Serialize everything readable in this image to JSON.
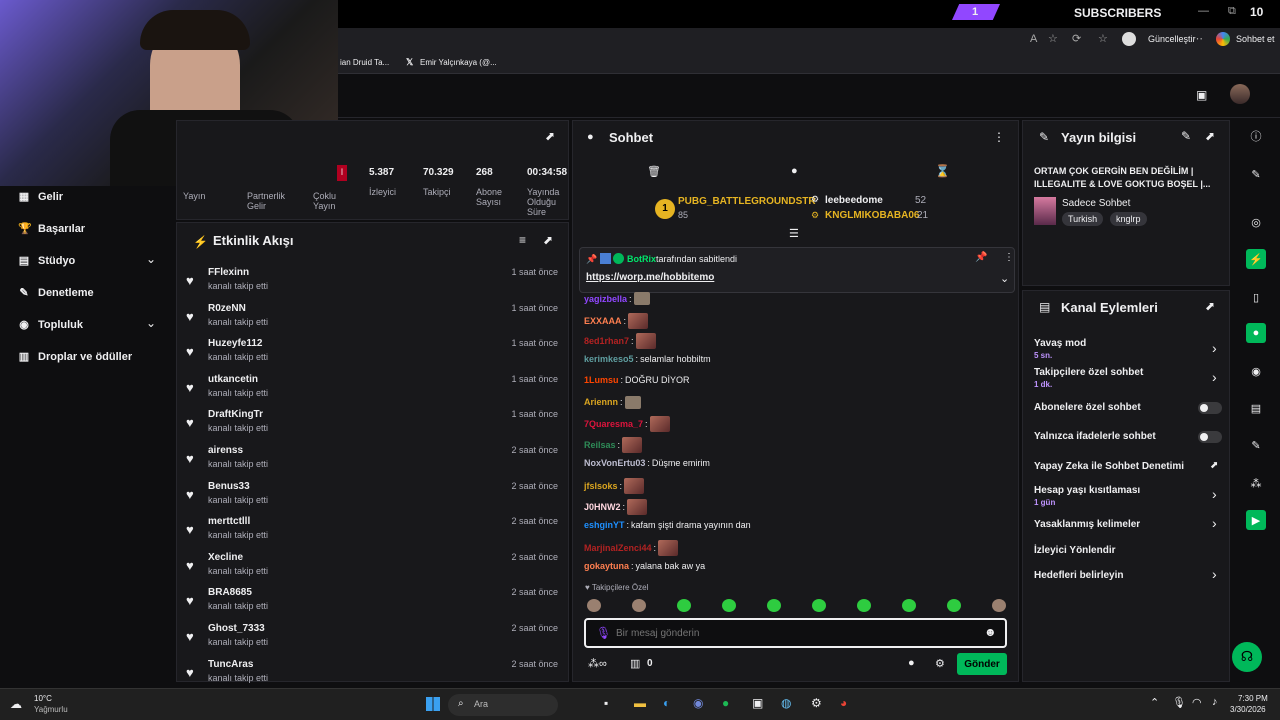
{
  "overlay": {
    "sub_count": "1",
    "subscribers_label": "SUBSCRIBERS",
    "sub_total": "10"
  },
  "browser": {
    "update_label": "Güncelleştir",
    "chat_tab": "Sohbet et",
    "bookmark1": "ian Druid Ta...",
    "bookmark2": "Emir Yalçınkaya (@..."
  },
  "stats": {
    "tiles": [
      {
        "value": "5.387",
        "label": "İzleyici"
      },
      {
        "value": "70.329",
        "label": "Takipçi"
      },
      {
        "value": "268",
        "label": "Abone Sayısı"
      },
      {
        "value": "00:34:58",
        "label": "Yayında Olduğu Süre"
      }
    ],
    "left_labels": [
      "Yayın",
      "Partnerlik Gelir",
      "Çoklu Yayın"
    ],
    "badge": "İ"
  },
  "sidebar": {
    "items": [
      {
        "label": "Gelir",
        "icon": "chart-icon"
      },
      {
        "label": "Başarılar",
        "icon": "trophy-icon"
      },
      {
        "label": "Stüdyo",
        "icon": "studio-icon"
      },
      {
        "label": "Denetleme",
        "icon": "wrench-icon"
      },
      {
        "label": "Topluluk",
        "icon": "community-icon"
      },
      {
        "label": "Droplar ve ödüller",
        "icon": "drops-icon"
      }
    ]
  },
  "feed": {
    "title": "Etkinlik Akışı",
    "items": [
      {
        "name": "FFlexinn",
        "sub": "kanalı takip etti",
        "time": "1 saat önce"
      },
      {
        "name": "R0zeNN",
        "sub": "kanalı takip etti",
        "time": "1 saat önce"
      },
      {
        "name": "Huzeyfe112",
        "sub": "kanalı takip etti",
        "time": "1 saat önce"
      },
      {
        "name": "utkancetin",
        "sub": "kanalı takip etti",
        "time": "1 saat önce"
      },
      {
        "name": "DraftKingTr",
        "sub": "kanalı takip etti",
        "time": "1 saat önce"
      },
      {
        "name": "airenss",
        "sub": "kanalı takip etti",
        "time": "2 saat önce"
      },
      {
        "name": "Benus33",
        "sub": "kanalı takip etti",
        "time": "2 saat önce"
      },
      {
        "name": "merttctlll",
        "sub": "kanalı takip etti",
        "time": "2 saat önce"
      },
      {
        "name": "Xecline",
        "sub": "kanalı takip etti",
        "time": "2 saat önce"
      },
      {
        "name": "BRA8685",
        "sub": "kanalı takip etti",
        "time": "2 saat önce"
      },
      {
        "name": "Ghost_7333",
        "sub": "kanalı takip etti",
        "time": "2 saat önce"
      },
      {
        "name": "TuncAras",
        "sub": "kanalı takip etti",
        "time": "2 saat önce"
      }
    ]
  },
  "chat": {
    "title": "Sohbet",
    "leaderboard": {
      "first": {
        "rank": "1",
        "name": "PUBG_BATTLEGROUNDSTR",
        "points": "85"
      },
      "second": {
        "name": "leebeedome",
        "points": "52"
      },
      "third": {
        "name": "KNGLMIKOBABA06",
        "points": "21"
      }
    },
    "pinned": {
      "by_user": "BotRix",
      "by_text": "tarafından sabitlendi",
      "link": "https://worp.me/hobbitemo"
    },
    "messages": [
      {
        "user": "yagizbella",
        "color": "#9147ff",
        "text": ""
      },
      {
        "user": "EXXAAA",
        "color": "#ff7f50",
        "text": ""
      },
      {
        "user": "8ed1rhan7",
        "color": "#b22222",
        "text": ""
      },
      {
        "user": "kerimkeso5",
        "color": "#5f9ea0",
        "text": "selamlar hobbiltm"
      },
      {
        "user": "1Lumsu",
        "color": "#ff4500",
        "text": "DOĞRU DİYOR"
      },
      {
        "user": "Ariennn",
        "color": "#daa520",
        "text": ""
      },
      {
        "user": "7Quaresma_7",
        "color": "#dc143c",
        "text": ""
      },
      {
        "user": "Reilsas",
        "color": "#2e8b57",
        "text": ""
      },
      {
        "user": "NoxVonErtu03",
        "color": "#bdbdd0",
        "text": "Düşme emirim"
      },
      {
        "user": "jfslsoks",
        "color": "#daa520",
        "text": ""
      },
      {
        "user": "J0HNW2",
        "color": "#ffd7e0",
        "text": ""
      },
      {
        "user": "eshginYT",
        "color": "#1e90ff",
        "text": "kafam şişti drama yayının dan"
      },
      {
        "user": "MarjinalZenci44",
        "color": "#b22222",
        "text": ""
      },
      {
        "user": "gokaytuna",
        "color": "#ff7f50",
        "text": "yalana bak aw ya"
      }
    ],
    "followers_only": "Takipçilere Özel",
    "input_placeholder": "Bir mesaj gönderin",
    "points": "0",
    "send_label": "Gönder"
  },
  "stream_info": {
    "title": "Yayın bilgisi",
    "stream_title": "ORTAM ÇOK GERGİN BEN DEĞİLİM | ILLEGALITE & LOVE GOKTUG BOŞEL |...",
    "category": "Sadece Sohbet",
    "tags": [
      "Turkish",
      "knglrp"
    ]
  },
  "channel_actions": {
    "title": "Kanal Eylemleri",
    "items": [
      {
        "label": "Yavaş mod",
        "value": "5 sn."
      },
      {
        "label": "Takipçilere özel sohbet",
        "value": "1 dk."
      },
      {
        "label": "Abonelere özel sohbet",
        "value": ""
      },
      {
        "label": "Yalnızca ifadelerle sohbet",
        "value": ""
      },
      {
        "label": "Yapay Zeka ile Sohbet Denetimi",
        "value": ""
      },
      {
        "label": "Hesap yaşı kısıtlaması",
        "value": "1 gün"
      },
      {
        "label": "Yasaklanmış kelimeler",
        "value": ""
      },
      {
        "label": "İzleyici Yönlendir",
        "value": ""
      },
      {
        "label": "Hedefleri belirleyin",
        "value": ""
      }
    ]
  },
  "taskbar": {
    "weather_temp": "10°C",
    "weather_desc": "Yağmurlu",
    "search_placeholder": "Ara",
    "time": "7:30 PM",
    "date": "3/30/2026"
  },
  "colors": {
    "accent": "#9147ff",
    "green": "#00b85a",
    "bg": "#0e0e10",
    "panel": "#18181b"
  }
}
